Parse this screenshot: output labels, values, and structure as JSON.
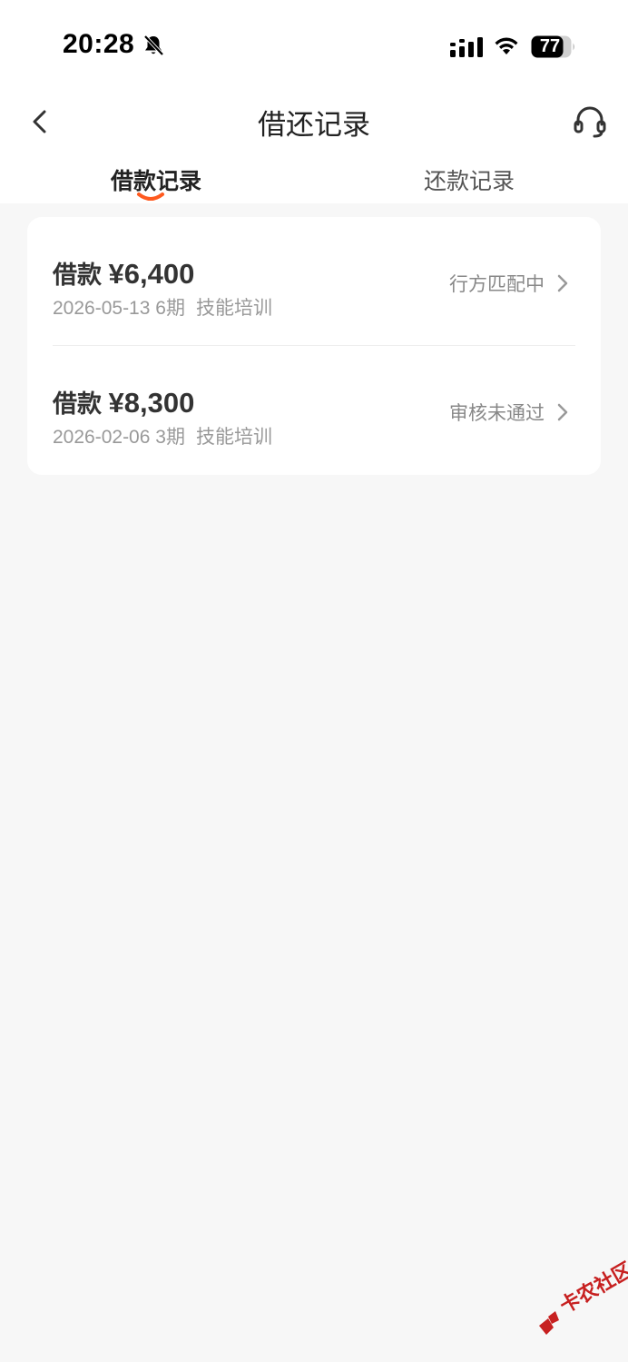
{
  "status_bar": {
    "time": "20:28",
    "battery": "77",
    "icons": [
      "bell-muted-icon",
      "signal-icon",
      "wifi-icon",
      "battery-icon"
    ]
  },
  "nav": {
    "title": "借还记录",
    "back_icon": "chevron-left-icon",
    "service_icon": "headset-icon"
  },
  "tabs": [
    {
      "label": "借款记录",
      "active": true
    },
    {
      "label": "还款记录",
      "active": false
    }
  ],
  "records": [
    {
      "label": "借款",
      "amount": "¥6,400",
      "date": "2026-05-13",
      "term": "6期",
      "purpose": "技能培训",
      "status": "行方匹配中"
    },
    {
      "label": "借款",
      "amount": "¥8,300",
      "date": "2026-02-06",
      "term": "3期",
      "purpose": "技能培训",
      "status": "审核未通过"
    }
  ],
  "colors": {
    "accent": "#ff5a1f",
    "background": "#f7f7f7",
    "card": "#ffffff",
    "watermark": "#c72020"
  },
  "watermark": {
    "text": "卡农社区"
  }
}
